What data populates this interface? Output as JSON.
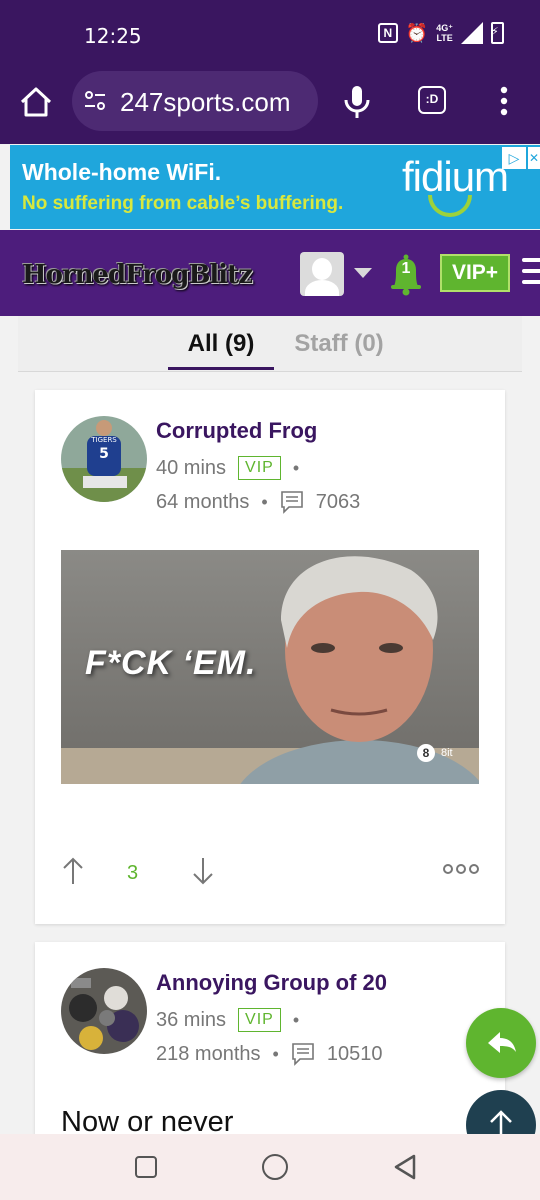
{
  "status_bar": {
    "time": "12:25",
    "network": "4G+ LTE"
  },
  "browser": {
    "url": "247sports.com",
    "tab_label": ":D"
  },
  "ad": {
    "headline": "Whole-home WiFi.",
    "tagline": "No suffering from cable’s buffering.",
    "brand": "fidium"
  },
  "site": {
    "logo": "HornedFrogBlitz",
    "notification_count": "1",
    "vip_button": "VIP+"
  },
  "tabs": [
    {
      "label": "All (9)",
      "active": true
    },
    {
      "label": "Staff (0)",
      "active": false
    }
  ],
  "posts": [
    {
      "author": "Corrupted Frog",
      "time_ago": "40 mins",
      "badge": "VIP",
      "tenure": "64 months",
      "post_count": "7063",
      "image_caption": "F*CK ‘EM.",
      "image_watermark": "8it",
      "votes": "3"
    },
    {
      "author": "Annoying Group of 20",
      "time_ago": "36 mins",
      "badge": "VIP",
      "tenure": "218 months",
      "post_count": "10510",
      "text": "Now or never"
    }
  ],
  "colors": {
    "primary_purple": "#3a1660",
    "header_purple": "#4d1d7c",
    "accent_green": "#5fb52f",
    "ad_blue": "#1fa6dc"
  }
}
